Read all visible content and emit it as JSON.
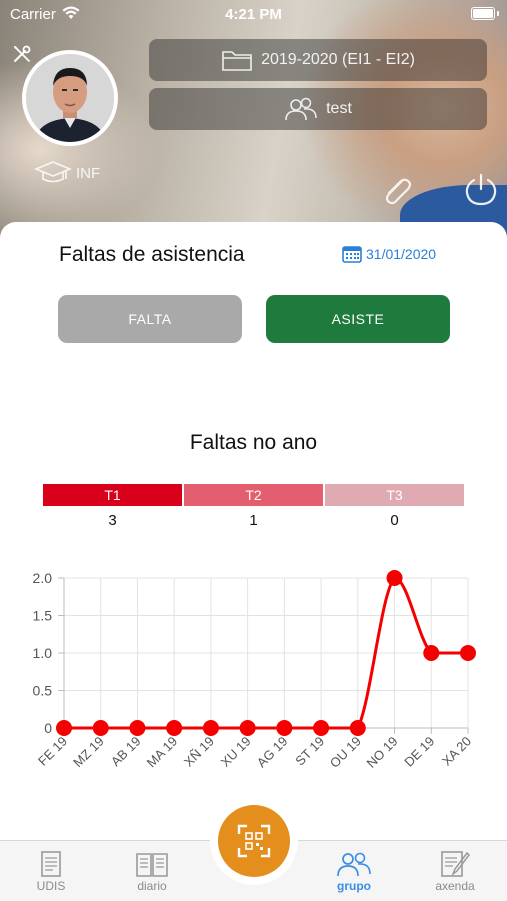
{
  "status_bar": {
    "carrier": "Carrier",
    "time": "4:21 PM"
  },
  "header": {
    "course": "2019-2020 (EI1 - EI2)",
    "group": "test",
    "role": "INF"
  },
  "attendance": {
    "title": "Faltas de asistencia",
    "date": "31/01/2020",
    "absent_label": "FALTA",
    "present_label": "ASISTE"
  },
  "year_summary": {
    "title": "Faltas no ano",
    "terms": [
      {
        "label": "T1",
        "count": "3",
        "color": "#d9001b"
      },
      {
        "label": "T2",
        "count": "1",
        "color": "#e35e6e"
      },
      {
        "label": "T3",
        "count": "0",
        "color": "#e0aab3"
      }
    ]
  },
  "chart_data": {
    "type": "line",
    "categories": [
      "FE 19",
      "MZ 19",
      "AB 19",
      "MA 19",
      "XÑ 19",
      "XU 19",
      "AG 19",
      "ST 19",
      "OU 19",
      "NO 19",
      "DE 19",
      "XA 20"
    ],
    "series": [
      {
        "values": [
          0,
          0,
          0,
          0,
          0,
          0,
          0,
          0,
          0,
          2,
          1,
          1
        ],
        "color": "#f40000"
      }
    ],
    "yticks": [
      "0",
      "0.5",
      "1.0",
      "1.5",
      "2.0"
    ],
    "ylim": [
      0,
      2
    ],
    "grid": true
  },
  "tabbar": {
    "items": [
      {
        "label": "UDIS"
      },
      {
        "label": "diario"
      },
      {
        "label": "grupo"
      },
      {
        "label": "axenda"
      }
    ]
  },
  "colors": {
    "primary": "#1f7a3d",
    "accent": "#e48e1d",
    "link": "#2a7fd6",
    "gray_button": "#a9a9a9"
  }
}
